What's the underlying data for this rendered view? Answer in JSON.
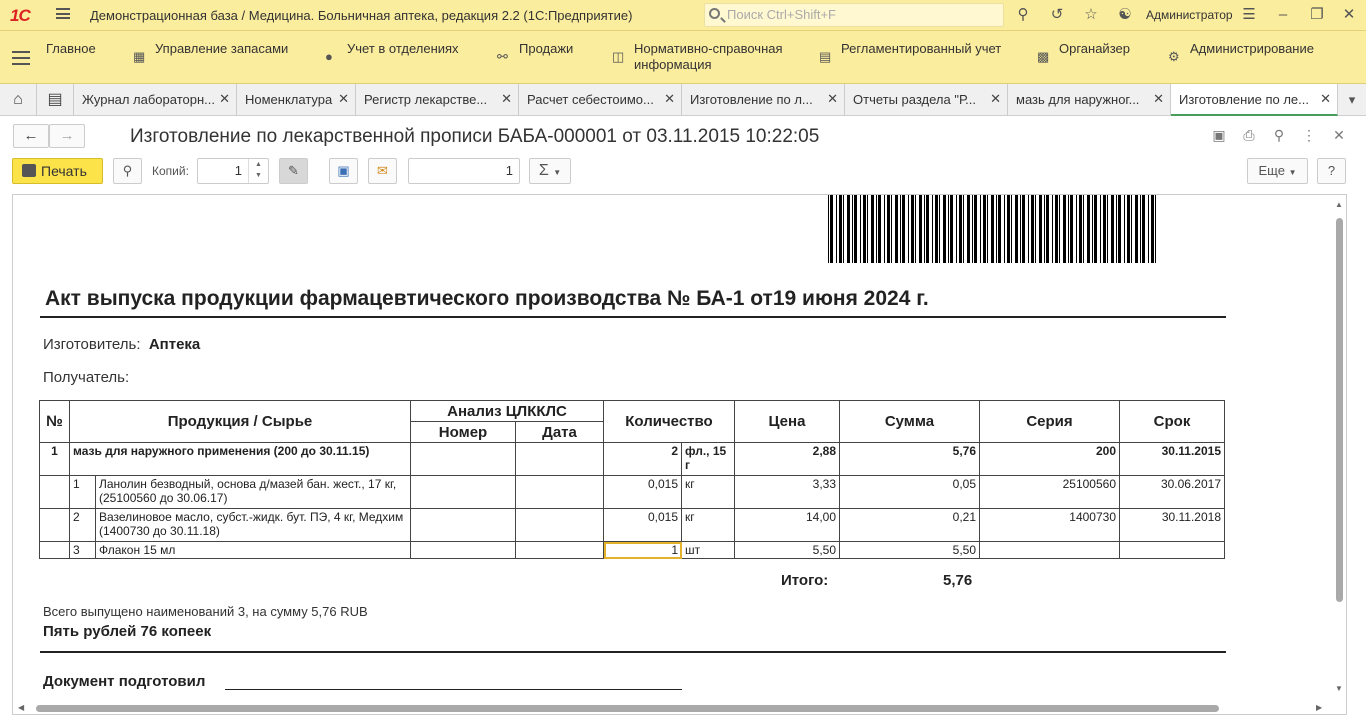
{
  "app": {
    "logo": "1С",
    "title": "Демонстрационная база / Медицина. Больничная аптека, редакция 2.2  (1С:Предприятие)",
    "search_placeholder": "Поиск Ctrl+Shift+F",
    "user": "Администратор"
  },
  "menu": [
    {
      "label": "Главное",
      "icon": "none"
    },
    {
      "label": "Управление запасами",
      "icon": "warehouse-icon"
    },
    {
      "label": "Учет в отделениях",
      "icon": "person-icon"
    },
    {
      "label": "Продажи",
      "icon": "basket-icon"
    },
    {
      "label": "Нормативно-справочная\nинформация",
      "icon": "book-icon"
    },
    {
      "label": "Регламентированный учет",
      "icon": "ledger-icon"
    },
    {
      "label": "Органайзер",
      "icon": "chart-icon"
    },
    {
      "label": "Администрирование",
      "icon": "gear-icon"
    }
  ],
  "tabs": [
    "Журнал лабораторн...",
    "Номенклатура",
    "Регистр лекарстве...",
    "Расчет себестоимо...",
    "Изготовление по л...",
    "Отчеты раздела \"Р...",
    "мазь для наружног...",
    "Изготовление по ле..."
  ],
  "document": {
    "title": "Изготовление по лекарственной прописи БАБА-000001 от 03.11.2015 10:22:05"
  },
  "toolbar": {
    "print_label": "Печать",
    "copies_label": "Копий:",
    "copies_value": "1",
    "field_value": "1",
    "sigma": "Σ",
    "more_label": "Еще",
    "help_label": "?"
  },
  "report": {
    "heading": "Акт выпуска продукции фармацевтического производства № БА-1 от19 июня 2024 г.",
    "maker_label": "Изготовитель:",
    "maker_value": "Аптека",
    "receiver_label": "Получатель:",
    "columns": {
      "num": "№",
      "product": "Продукция / Сырье",
      "analysis": "Анализ ЦЛККЛС",
      "analysis_num": "Номер",
      "analysis_date": "Дата",
      "qty": "Количество",
      "price": "Цена",
      "sum": "Сумма",
      "series": "Серия",
      "term": "Срок"
    },
    "main_row": {
      "num": "1",
      "product": "мазь для наружного применения (200 до 30.11.15)",
      "qty": "2",
      "unit": "фл., 15 г",
      "price": "2,88",
      "sum": "5,76",
      "series": "200",
      "term": "30.11.2015"
    },
    "sub_rows": [
      {
        "num": "1",
        "product": "Ланолин безводный, основа д/мазей бан. жест., 17 кг, (25100560 до 30.06.17)",
        "qty": "0,015",
        "unit": "кг",
        "price": "3,33",
        "sum": "0,05",
        "series": "25100560",
        "term": "30.06.2017"
      },
      {
        "num": "2",
        "product": "Вазелиновое масло, субст.-жидк. бут. ПЭ, 4 кг, Медхим (1400730 до 30.11.18)",
        "qty": "0,015",
        "unit": "кг",
        "price": "14,00",
        "sum": "0,21",
        "series": "1400730",
        "term": "30.11.2018"
      },
      {
        "num": "3",
        "product": "Флакон 15 мл",
        "qty": "1",
        "unit": "шт",
        "price": "5,50",
        "sum": "5,50",
        "series": "",
        "term": ""
      }
    ],
    "total_label": "Итого:",
    "total_value": "5,76",
    "summary": "Всего выпущено наименований 3, на сумму 5,76 RUB",
    "amount_words": "Пять рублей 76 копеек",
    "prepared_by": "Документ подготовил"
  }
}
